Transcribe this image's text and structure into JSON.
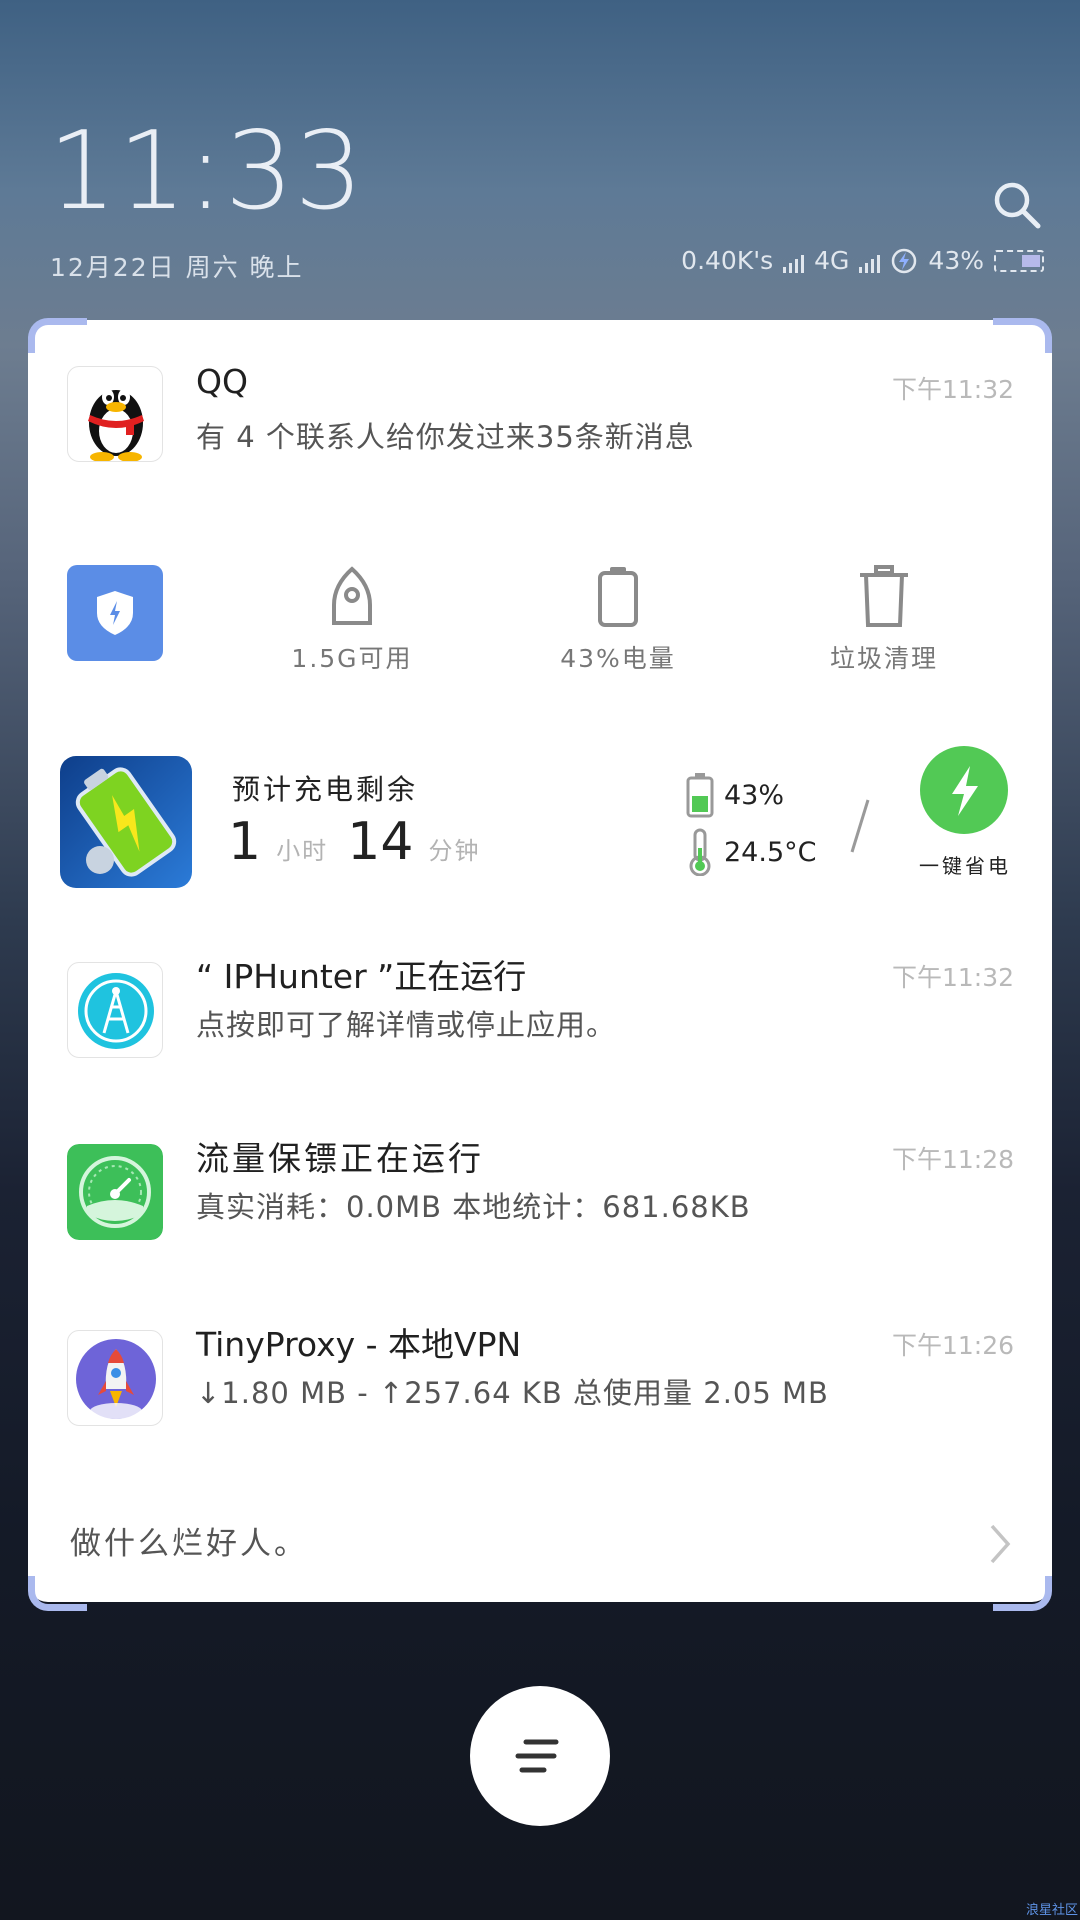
{
  "lockscreen": {
    "time": "11:33",
    "date": "12月22日 周六 晚上",
    "network_speed": "0.40K's",
    "network_type": "4G",
    "battery_percent": "43%",
    "battery_level": 0.43
  },
  "colors": {
    "accent_blue": "#5b8de6",
    "accent_green": "#52c955",
    "panel_corner": "#aab9ee"
  },
  "icons": {
    "search": "search-icon",
    "shield": "shield-icon",
    "rocket": "rocket-icon",
    "battery": "battery-icon",
    "trash": "trash-icon",
    "bolt": "lightning-icon",
    "thermometer": "thermometer-icon",
    "chevron": "chevron-right-icon",
    "menu": "menu-lines-icon"
  },
  "notifications": {
    "qq": {
      "title": "QQ",
      "text": "有 4 个联系人给你发过来35条新消息",
      "time": "下午11:32"
    },
    "iphunter": {
      "title": "“ IPHunter ”正在运行",
      "text": "点按即可了解详情或停止应用。",
      "time": "下午11:32"
    },
    "traffic": {
      "title": "流量保镖正在运行",
      "text": "真实消耗：0.0MB   本地统计：681.68KB",
      "time": "下午11:28"
    },
    "tinyproxy": {
      "title": "TinyProxy - 本地VPN",
      "text": "↓1.80 MB - ↑257.64 KB 总使用量 2.05 MB",
      "time": "下午11:26"
    }
  },
  "tools": {
    "memory": "1.5G可用",
    "battery": "43%电量",
    "clean": "垃圾清理"
  },
  "charging": {
    "label": "预计充电剩余",
    "hours": "1",
    "hours_unit": "小时",
    "minutes": "14",
    "minutes_unit": "分钟",
    "battery": "43%",
    "temperature": "24.5°C",
    "save_label": "一键省电"
  },
  "footer": {
    "text": "做什么烂好人。"
  },
  "watermark": "浪星社区"
}
